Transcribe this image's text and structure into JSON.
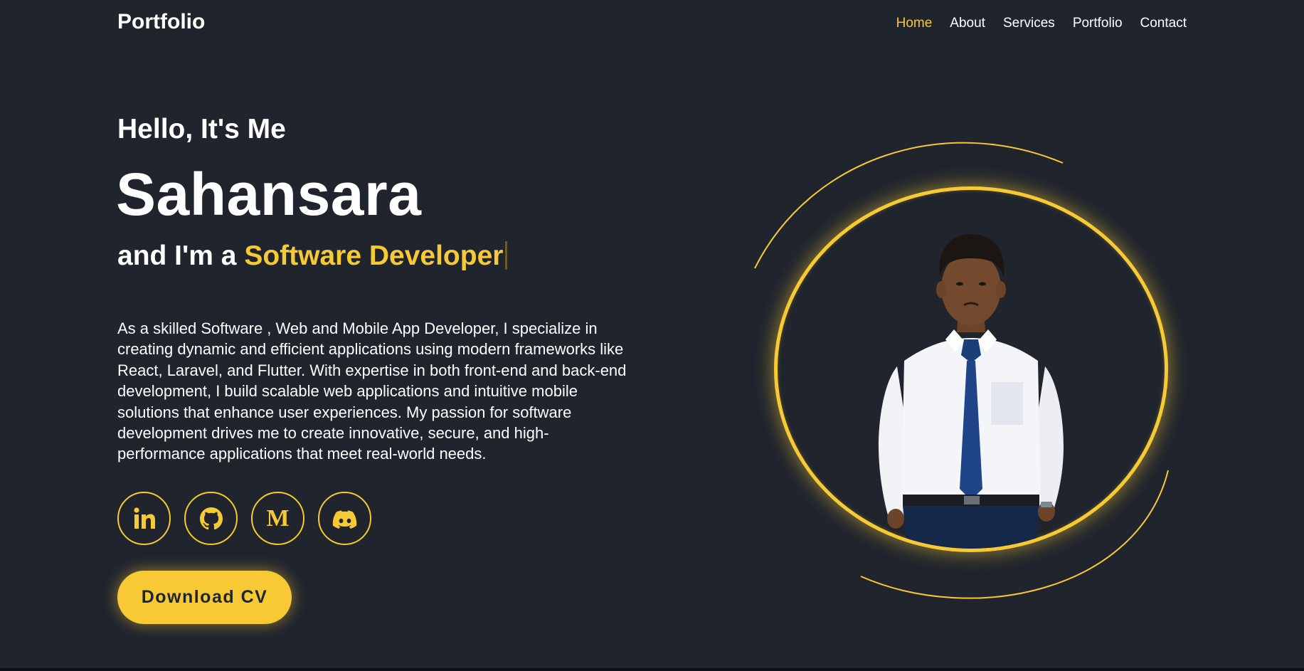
{
  "header": {
    "logo": "Portfolio",
    "nav": [
      {
        "label": "Home",
        "active": true
      },
      {
        "label": "About",
        "active": false
      },
      {
        "label": "Services",
        "active": false
      },
      {
        "label": "Portfolio",
        "active": false
      },
      {
        "label": "Contact",
        "active": false
      }
    ]
  },
  "hero": {
    "greeting": "Hello, It's Me",
    "name": "Sahansara",
    "role_prefix": "and I'm a ",
    "role_highlight": "Software Developer",
    "description": "As a skilled Software , Web and Mobile App Developer, I specialize in creating dynamic and efficient applications using modern frameworks like React, Laravel, and Flutter. With expertise in both front-end and back-end development, I build scalable web applications and intuitive mobile solutions that enhance user experiences. My passion for software development drives me to create innovative, secure, and high-performance applications that meet real-world needs.",
    "social_icons": [
      "linkedin-icon",
      "github-icon",
      "medium-icon",
      "discord-icon"
    ],
    "medium_glyph": "M",
    "cta_label": "Download CV"
  },
  "colors": {
    "background": "#1f242d",
    "accent": "#f7c934",
    "text": "#ffffff"
  }
}
